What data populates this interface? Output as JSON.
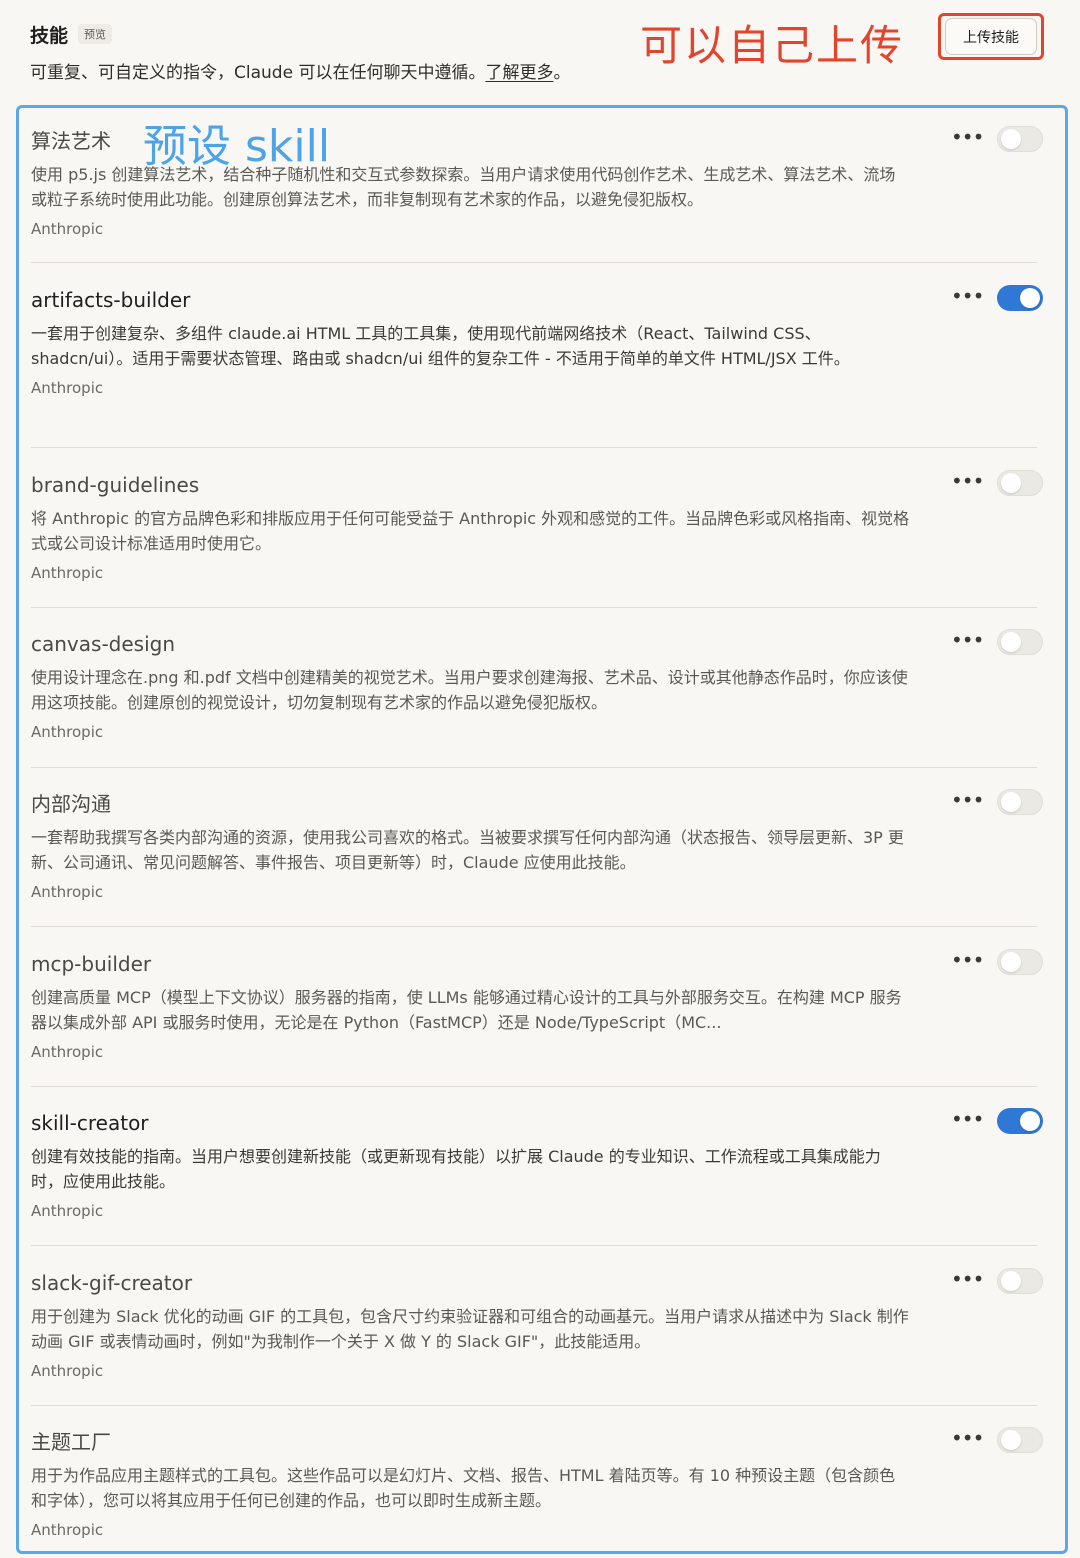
{
  "header": {
    "title": "技能",
    "badge": "预览",
    "subtitle_prefix": "可重复、可自定义的指令，Claude 可以在任何聊天中遵循。",
    "learn_more": "了解更多",
    "subtitle_suffix": "。",
    "upload_label": "上传技能"
  },
  "annotations": {
    "upload_note": "可以自己上传",
    "preset_note": "预设 skill",
    "upload_color": "#e2452b",
    "preset_color": "#4da3e8"
  },
  "skills": [
    {
      "name": "算法艺术",
      "desc": "使用 p5.js 创建算法艺术，结合种子随机性和交互式参数探索。当用户请求使用代码创作艺术、生成艺术、算法艺术、流场或粒子系统时使用此功能。创建原创算法艺术，而非复制现有艺术家的作品，以避免侵犯版权。",
      "author": "Anthropic",
      "enabled": false
    },
    {
      "name": "artifacts-builder",
      "desc": "一套用于创建复杂、多组件 claude.ai HTML 工具的工具集，使用现代前端网络技术（React、Tailwind CSS、shadcn/ui）。适用于需要状态管理、路由或 shadcn/ui 组件的复杂工件 - 不适用于简单的单文件 HTML/JSX 工件。",
      "author": "Anthropic",
      "enabled": true
    },
    {
      "name": "brand-guidelines",
      "desc": "将 Anthropic 的官方品牌色彩和排版应用于任何可能受益于 Anthropic 外观和感觉的工件。当品牌色彩或风格指南、视觉格式或公司设计标准适用时使用它。",
      "author": "Anthropic",
      "enabled": false
    },
    {
      "name": "canvas-design",
      "desc": "使用设计理念在.png 和.pdf 文档中创建精美的视觉艺术。当用户要求创建海报、艺术品、设计或其他静态作品时，你应该使用这项技能。创建原创的视觉设计，切勿复制现有艺术家的作品以避免侵犯版权。",
      "author": "Anthropic",
      "enabled": false
    },
    {
      "name": "内部沟通",
      "desc": "一套帮助我撰写各类内部沟通的资源，使用我公司喜欢的格式。当被要求撰写任何内部沟通（状态报告、领导层更新、3P 更新、公司通讯、常见问题解答、事件报告、项目更新等）时，Claude 应使用此技能。",
      "author": "Anthropic",
      "enabled": false
    },
    {
      "name": "mcp-builder",
      "desc": "创建高质量 MCP（模型上下文协议）服务器的指南，使 LLMs 能够通过精心设计的工具与外部服务交互。在构建 MCP 服务器以集成外部 API 或服务时使用，无论是在 Python（FastMCP）还是 Node/TypeScript（MC...",
      "author": "Anthropic",
      "enabled": false
    },
    {
      "name": "skill-creator",
      "desc": "创建有效技能的指南。当用户想要创建新技能（或更新现有技能）以扩展 Claude 的专业知识、工作流程或工具集成能力时，应使用此技能。",
      "author": "Anthropic",
      "enabled": true
    },
    {
      "name": "slack-gif-creator",
      "desc": "用于创建为 Slack 优化的动画 GIF 的工具包，包含尺寸约束验证器和可组合的动画基元。当用户请求从描述中为 Slack 制作动画 GIF 或表情动画时，例如\"为我制作一个关于 X 做 Y 的 Slack GIF\"，此技能适用。",
      "author": "Anthropic",
      "enabled": false
    },
    {
      "name": "主题工厂",
      "desc": "用于为作品应用主题样式的工具包。这些作品可以是幻灯片、文档、报告、HTML 着陆页等。有 10 种预设主题（包含颜色和字体），您可以将其应用于任何已创建的作品，也可以即时生成新主题。",
      "author": "Anthropic",
      "enabled": false
    }
  ]
}
